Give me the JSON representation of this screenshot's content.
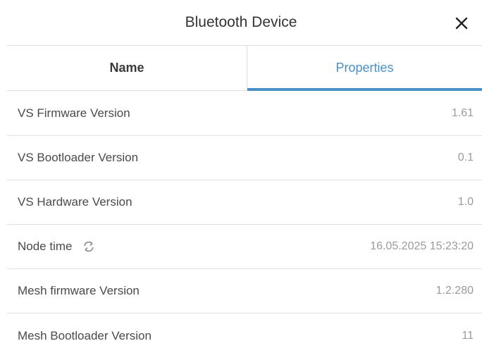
{
  "dialog": {
    "title": "Bluetooth Device",
    "close_icon": "close-icon"
  },
  "tabs": [
    {
      "label": "Name",
      "active": false
    },
    {
      "label": "Properties",
      "active": true
    }
  ],
  "colors": {
    "accent": "#4a90c8",
    "text": "#4a4a4a",
    "muted": "#9a9a9a",
    "divider": "#e2e2e2"
  },
  "properties": [
    {
      "label": "VS Firmware Version",
      "value": "1.61"
    },
    {
      "label": "VS Bootloader Version",
      "value": "0.1"
    },
    {
      "label": "VS Hardware Version",
      "value": "1.0"
    },
    {
      "label": "Node time",
      "value": "16.05.2025 15:23:20",
      "icon": "refresh-icon"
    },
    {
      "label": "Mesh firmware Version",
      "value": "1.2.280"
    },
    {
      "label": "Mesh Bootloader Version",
      "value": "11"
    }
  ]
}
